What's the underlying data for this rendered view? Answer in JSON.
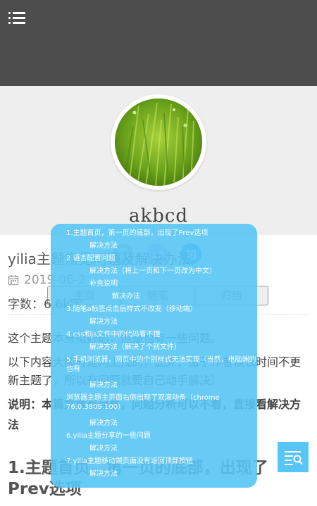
{
  "profile": {
    "author_name": "akbcd",
    "social": [
      "github-icon",
      "weibo-icon",
      "zhihu-icon"
    ],
    "zhihu_glyph": "知"
  },
  "nav_tabs": [
    {
      "label": "主页"
    },
    {
      "label": "随笔"
    },
    {
      "label": "归档"
    }
  ],
  "article": {
    "title": "yilia主题常见问题及解决办法",
    "date": "2019-06-2",
    "word_count": "字数：6.6k字",
    "para1": "这个主题本身挺好的，但是也有一些问题。",
    "para2": "以下内容大部分是网上找的，此外，由于作者很长时间不更新主题了，所以有问题就要自己动手解决）",
    "note": "说明：本篇文章有目录，问题分析可以不看，直接看解决方法",
    "heading1": "1.主题首页，第一页的底部，出现了Prev选项"
  },
  "toc": {
    "items": [
      {
        "text": "1.主题首页，第一页的底部，出现了Prev选项"
      },
      {
        "text": "解决方法"
      },
      {
        "text": "2.语言配置问题"
      },
      {
        "text": "解决方法（将上一页和下一页改为中文）"
      },
      {
        "text": "补充说明"
      },
      {
        "text": "解决办法"
      },
      {
        "text": "3.随笔a标签点击后样式不改变（移动端）"
      },
      {
        "text": "解决方法"
      },
      {
        "text": "4.css和js文件中的代码看不懂"
      },
      {
        "text": "解决方法（解决了个别文件）"
      },
      {
        "text": "5.手机浏览器，网页中的个别样式无法实现（当然，电脑端的也有"
      },
      {
        "text": "解决方法"
      },
      {
        "text": "浏览器主题主页面右侧出现了双滚动条（chrome 76.0.3809.100）"
      },
      {
        "text": "解决方法"
      },
      {
        "text": "6.yilia主题分享的一些问题"
      },
      {
        "text": "解决方法"
      },
      {
        "text": "7.yilia主题移动端页面没有返回顶部按钮"
      },
      {
        "text": "解决方法"
      }
    ]
  },
  "colors": {
    "header_bg": "#4d4d4d",
    "profile_bg": "#eeeeee",
    "toc_bg": "#57c5f5",
    "zhihu": "#3c8fdc"
  },
  "icons": {
    "menu": "hamburger-menu-icon",
    "date": "calendar-icon",
    "toc_toggle": "toc-list-icon"
  }
}
